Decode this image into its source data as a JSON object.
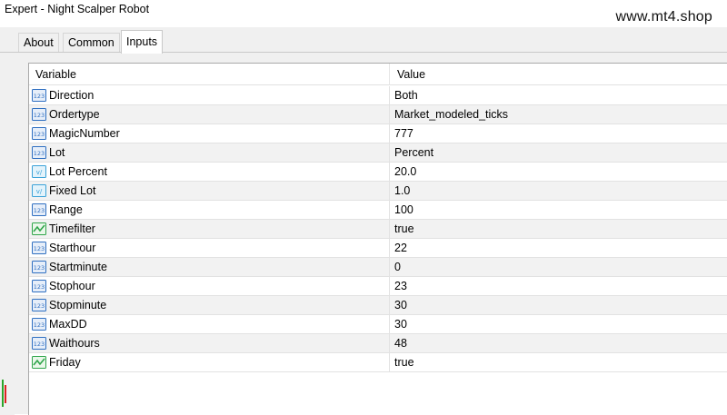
{
  "window": {
    "title": "Expert - Night Scalper Robot",
    "watermark": "www.mt4.shop"
  },
  "tabs": [
    {
      "label": "About",
      "active": false
    },
    {
      "label": "Common",
      "active": false
    },
    {
      "label": "Inputs",
      "active": true
    }
  ],
  "table": {
    "columns": [
      "Variable",
      "Value"
    ],
    "rows": [
      {
        "icon": "integer-param-icon",
        "variable": "Direction",
        "value": "Both"
      },
      {
        "icon": "integer-param-icon",
        "variable": "Ordertype",
        "value": "Market_modeled_ticks"
      },
      {
        "icon": "integer-param-icon",
        "variable": "MagicNumber",
        "value": "777"
      },
      {
        "icon": "integer-param-icon",
        "variable": "Lot",
        "value": "Percent"
      },
      {
        "icon": "double-param-icon",
        "variable": "Lot Percent",
        "value": "20.0"
      },
      {
        "icon": "double-param-icon",
        "variable": "Fixed Lot",
        "value": "1.0"
      },
      {
        "icon": "integer-param-icon",
        "variable": "Range",
        "value": "100"
      },
      {
        "icon": "boolean-param-icon",
        "variable": "Timefilter",
        "value": "true"
      },
      {
        "icon": "integer-param-icon",
        "variable": "Starthour",
        "value": "22"
      },
      {
        "icon": "integer-param-icon",
        "variable": "Startminute",
        "value": "0"
      },
      {
        "icon": "integer-param-icon",
        "variable": "Stophour",
        "value": "23"
      },
      {
        "icon": "integer-param-icon",
        "variable": "Stopminute",
        "value": "30"
      },
      {
        "icon": "integer-param-icon",
        "variable": "MaxDD",
        "value": "30"
      },
      {
        "icon": "integer-param-icon",
        "variable": "Waithours",
        "value": "48"
      },
      {
        "icon": "boolean-param-icon",
        "variable": "Friday",
        "value": "true"
      }
    ]
  },
  "colors": {
    "integer_icon": "#2f6fc1",
    "double_icon": "#3aa2d8",
    "boolean_icon": "#2fa54a"
  }
}
